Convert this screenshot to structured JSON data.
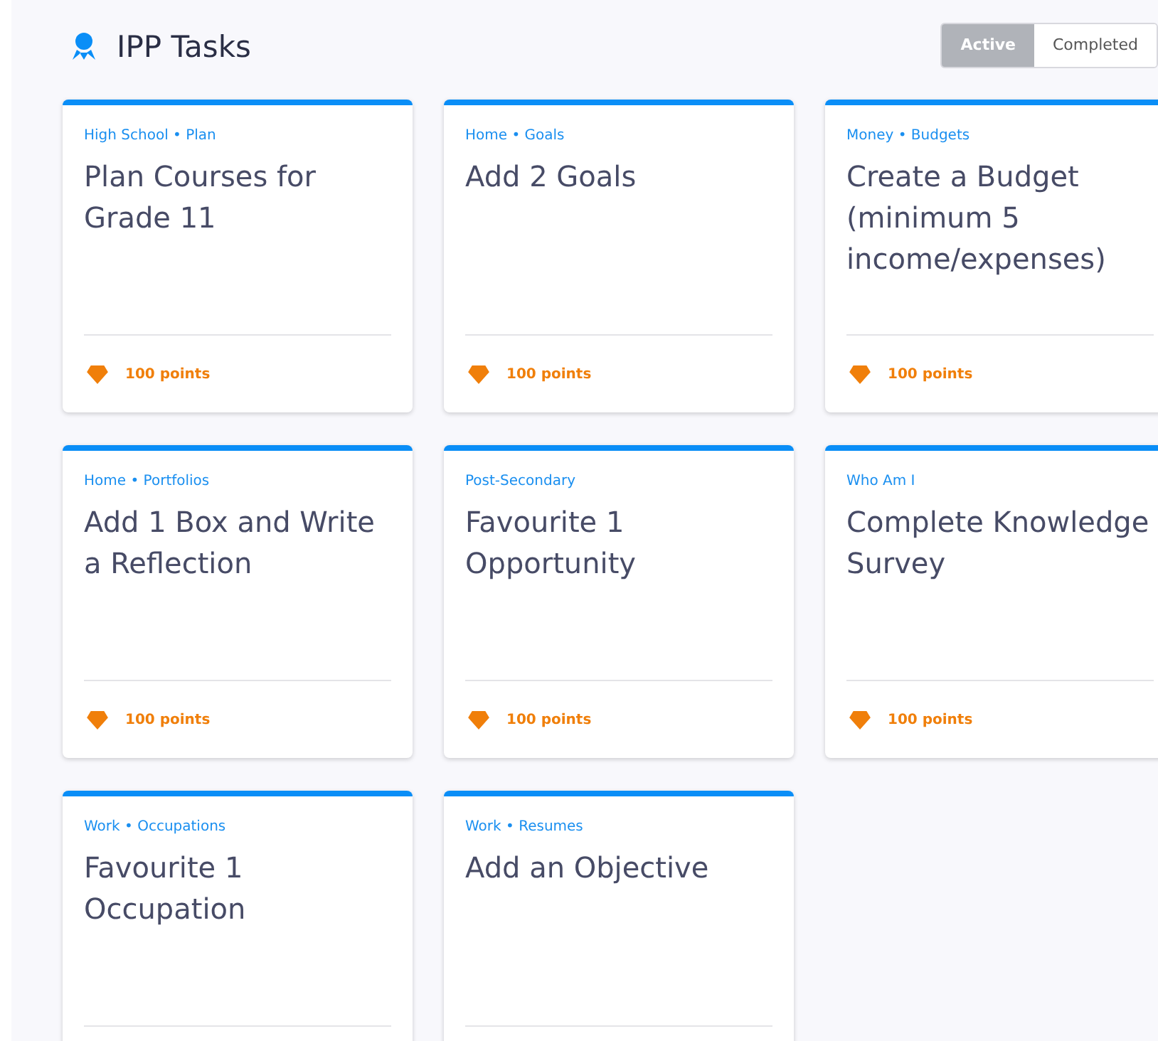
{
  "header": {
    "title": "IPP Tasks"
  },
  "filter_tabs": [
    {
      "label": "Active",
      "selected": true
    },
    {
      "label": "Completed",
      "selected": false
    }
  ],
  "tasks": [
    {
      "category": "High School • Plan",
      "title": "Plan Courses for Grade 11",
      "points": "100 points"
    },
    {
      "category": "Home • Goals",
      "title": "Add 2 Goals",
      "points": "100 points"
    },
    {
      "category": "Money • Budgets",
      "title": "Create a Budget (minimum 5 income/expenses)",
      "points": "100 points"
    },
    {
      "category": "Home • Portfolios",
      "title": "Add 1 Box and Write a Reflection",
      "points": "100 points"
    },
    {
      "category": "Post-Secondary",
      "title": "Favourite 1 Opportunity",
      "points": "100 points"
    },
    {
      "category": "Who Am I",
      "title": "Complete Knowledge Survey",
      "points": "100 points"
    },
    {
      "category": "Work • Occupations",
      "title": "Favourite 1 Occupation"
    },
    {
      "category": "Work • Resumes",
      "title": "Add an Objective"
    }
  ]
}
